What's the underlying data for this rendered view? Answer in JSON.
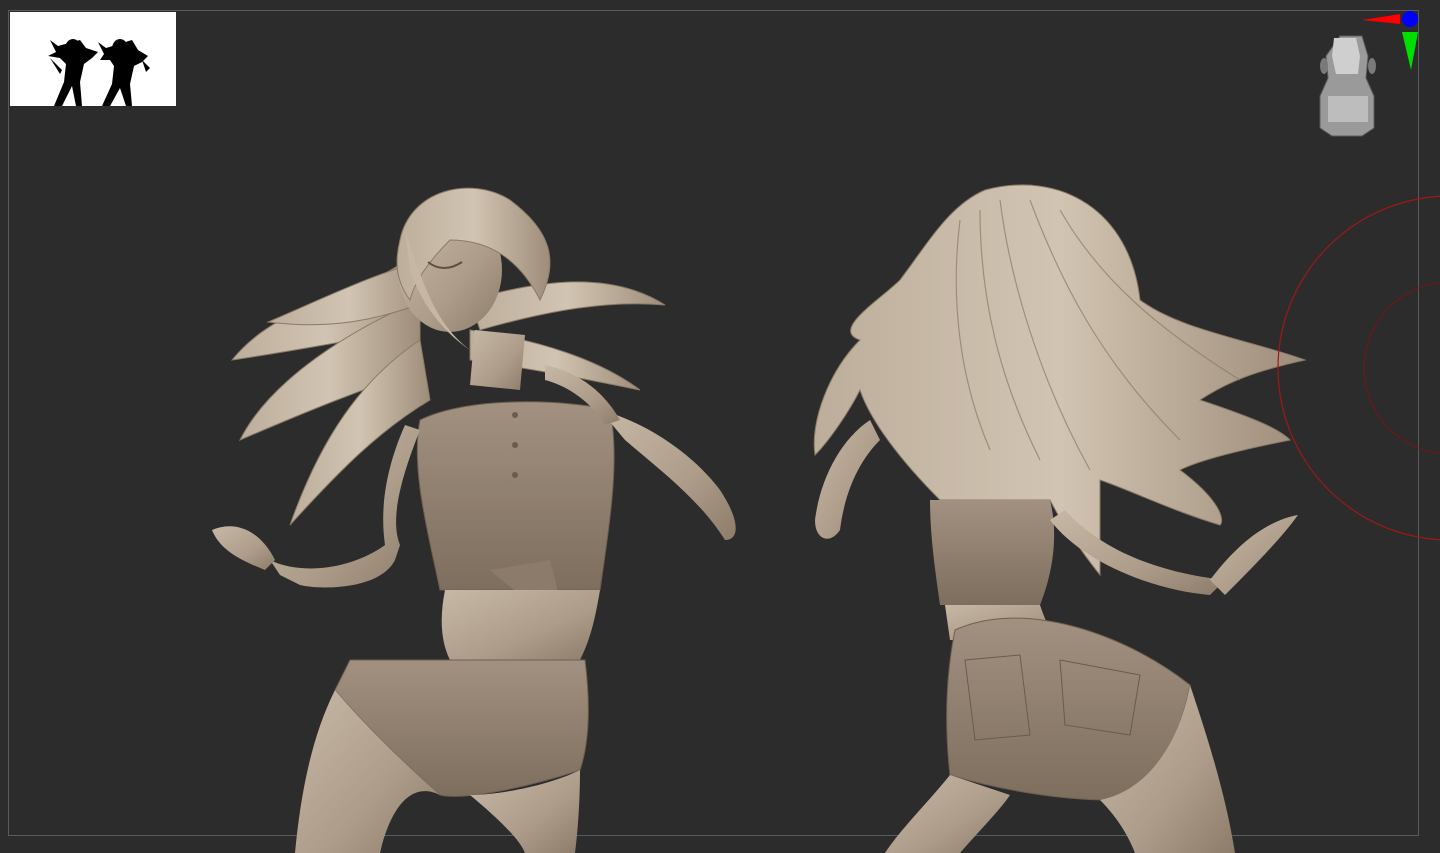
{
  "viewport": {
    "background": "#2c2c2c",
    "frame_color": "#5a5a5a",
    "sculpt_material_color": "#b5a594"
  },
  "thumbnail": {
    "background": "#ffffff",
    "silhouette_color": "#000000"
  },
  "navigation": {
    "x_axis_color": "#ff0000",
    "y_axis_color": "#00dd00",
    "z_axis_color": "#0000ff",
    "head_icon": "navigation-head-icon"
  },
  "brush": {
    "ring_color": "#a01818"
  }
}
